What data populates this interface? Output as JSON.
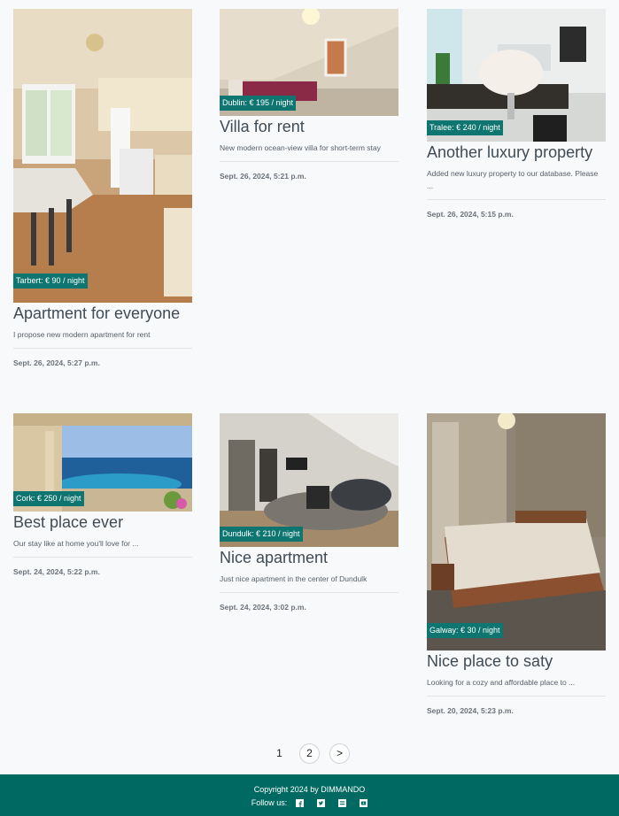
{
  "listings": [
    {
      "badge": "Tarbert: € 90 / night",
      "title": "Apartment for everyone",
      "description": "I propose new modern apartment for rent",
      "date": "Sept. 26, 2024, 5:27 p.m."
    },
    {
      "badge": "Dublin: € 195 / night",
      "title": "Villa for rent",
      "description": "New modern ocean-view villa for short-term stay",
      "date": "Sept. 26, 2024, 5:21 p.m."
    },
    {
      "badge": "Tralee: € 240 / night",
      "title": "Another luxury property",
      "description": "Added new luxury property to our database. Please ...",
      "date": "Sept. 26, 2024, 5:15 p.m."
    },
    {
      "badge": "Cork: € 250 / night",
      "title": "Best place ever",
      "description": "Our stay like at home you'll love for ...",
      "date": "Sept. 24, 2024, 5:22 p.m."
    },
    {
      "badge": "Dundulk: € 210 / night",
      "title": "Nice apartment",
      "description": "Just nice apartment in the center of Dundulk",
      "date": "Sept. 24, 2024, 3:02 p.m."
    },
    {
      "badge": "Galway: € 30 / night",
      "title": "Nice place to saty",
      "description": "Looking for a cozy and affordable place to ...",
      "date": "Sept. 20, 2024, 5:23 p.m."
    }
  ],
  "pagination": {
    "current": "1",
    "page2": "2",
    "next": ">"
  },
  "footer": {
    "copyright": "Copyright 2024 by DIMMANDO",
    "follow_label": "Follow us:",
    "social_icons": [
      "facebook-icon",
      "twitter-icon",
      "linkedin-icon",
      "youtube-icon"
    ]
  },
  "colors": {
    "accent": "#0f7570",
    "footer_bg": "#006a62",
    "page_bg": "#f8f9fb"
  }
}
